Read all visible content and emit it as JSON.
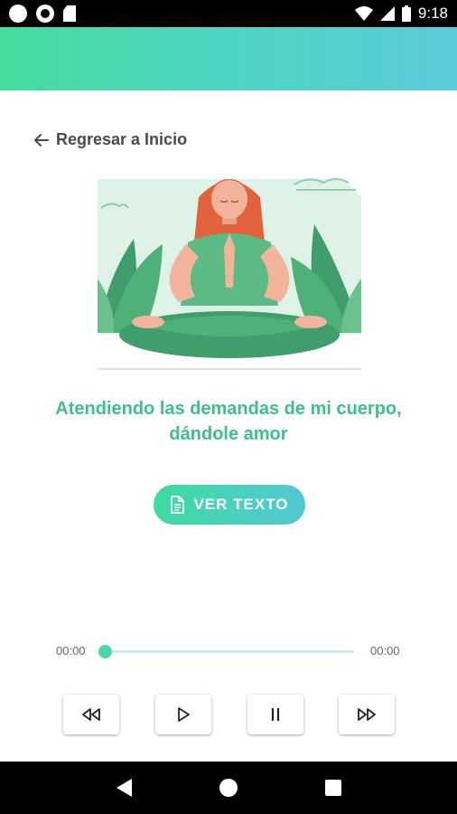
{
  "status_bar": {
    "time": "9:18"
  },
  "back_link": {
    "label": "Regresar a Inicio"
  },
  "meditation": {
    "title_line1": "Atendiendo las demandas de mi cuerpo,",
    "title_line2": "dándole amor"
  },
  "ver_texto_button": {
    "label": "VER TEXTO"
  },
  "player": {
    "current_time": "00:00",
    "total_time": "00:00",
    "progress": 0
  },
  "colors": {
    "accent_green": "#3cc08e",
    "header_gradient_start": "#45dc9d",
    "header_gradient_end": "#5acbd8"
  }
}
